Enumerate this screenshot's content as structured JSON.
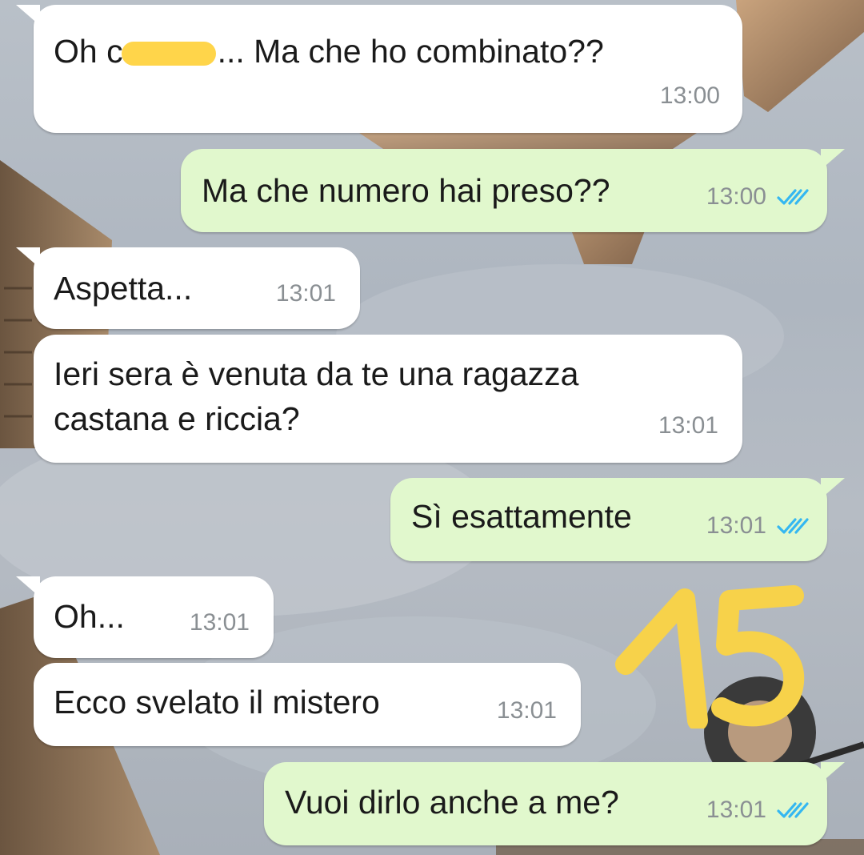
{
  "messages": [
    {
      "direction": "in",
      "text_pre": "Oh c",
      "text_post": "... Ma che ho combinato??",
      "time": "13:00"
    },
    {
      "direction": "out",
      "text": "Ma che numero hai preso??",
      "time": "13:00",
      "status": "read"
    },
    {
      "direction": "in",
      "text": "Aspetta...",
      "time": "13:01"
    },
    {
      "direction": "in",
      "text": "Ieri sera è venuta da te una ragazza\ncastana e riccia?",
      "time": "13:01"
    },
    {
      "direction": "out",
      "text": "Sì esattamente",
      "time": "13:01",
      "status": "read"
    },
    {
      "direction": "in",
      "text": "Oh...",
      "time": "13:01"
    },
    {
      "direction": "in",
      "text": "Ecco svelato il mistero",
      "time": "13:01"
    },
    {
      "direction": "out",
      "text": "Vuoi dirlo anche a me?",
      "time": "13:01",
      "status": "read"
    }
  ],
  "annotation": {
    "text": "15",
    "color": "#f7d24a"
  },
  "colors": {
    "incoming_bubble": "#ffffff",
    "outgoing_bubble": "#e1f8cd",
    "timestamp": "#8a8f93",
    "read_ticks": "#34b7f1",
    "redaction": "#ffd54a"
  }
}
